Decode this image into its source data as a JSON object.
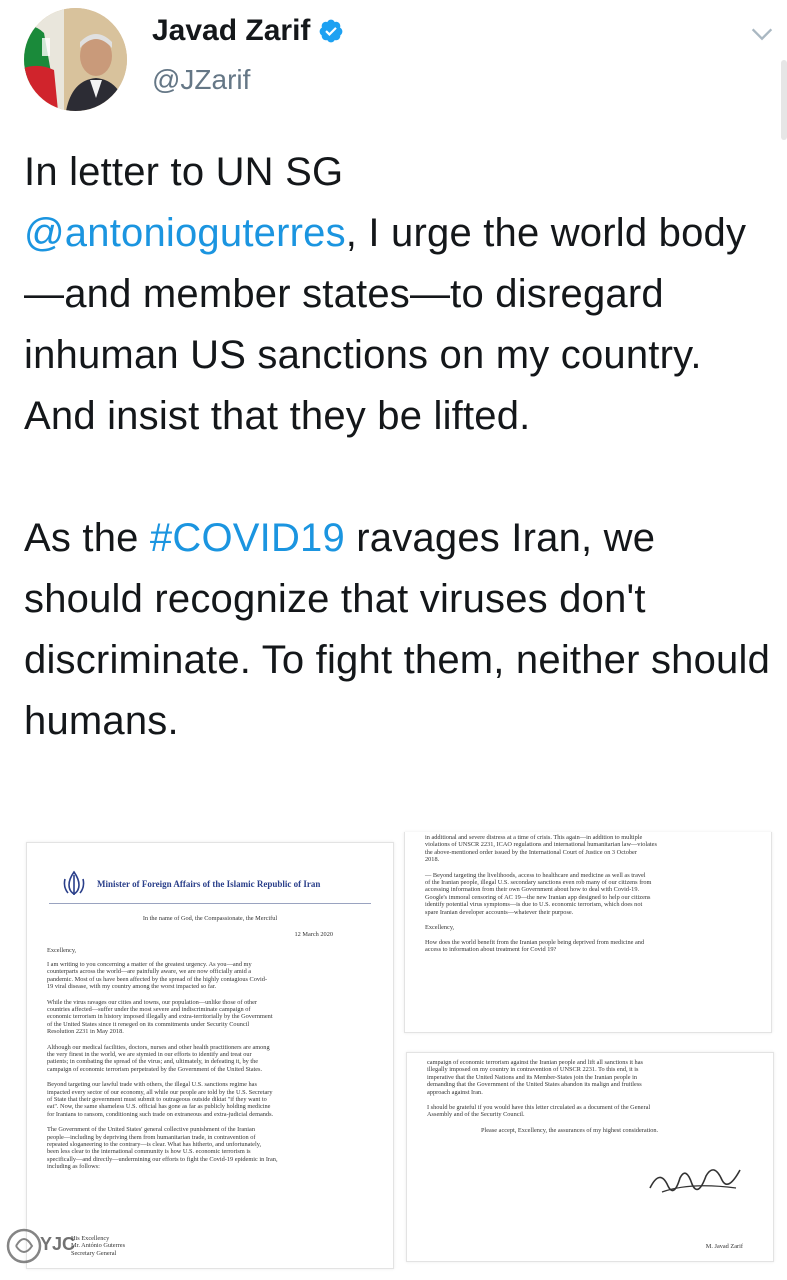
{
  "author": {
    "name": "Javad Zarif",
    "handle": "@JZarif"
  },
  "tweet": {
    "p1_a": "In letter to UN SG",
    "mention": "@antonioguterres",
    "p1_b": ", I urge the world body—and member states—to disregard inhuman US sanctions on my country. And insist that they be lifted.",
    "p2_a": "As the ",
    "hashtag": "#COVID19",
    "p2_b": " ravages Iran, we should recognize that viruses don't discriminate. To fight them, neither should humans."
  },
  "letter1": {
    "ministry": "Minister of Foreign Affairs of the Islamic Republic of Iran",
    "invocation": "In the name of God, the Compassionate, the Merciful",
    "date": "12 March 2020",
    "salutation": "Excellency,",
    "para1": [
      "I am writing to you concerning a matter of the greatest urgency. As you—and my",
      "counterparts across the world—are painfully aware, we are now officially amid a",
      "pandemic. Most of us have been affected by the spread of the highly contagious Covid-",
      "19 viral disease, with my country among the worst impacted so far."
    ],
    "para2": [
      "While the virus ravages our cities and towns, our population—unlike those of other",
      "countries affected—suffer under the most severe and indiscriminate campaign of",
      "economic terrorism in history imposed illegally and extra-territorially by the Government",
      "of the United States since it reneged on its commitments under Security Council",
      "Resolution 2231 in May 2018."
    ],
    "para3": [
      "Although our medical facilities, doctors, nurses and other health practitioners are among",
      "the very finest in the world, we are stymied in our efforts to identify and treat our",
      "patients; in combating the spread of the virus; and, ultimately, in defeating it, by the",
      "campaign of economic terrorism perpetrated by the Government of the United States."
    ],
    "para4": [
      "Beyond targeting our lawful trade with others, the illegal U.S. sanctions regime has",
      "impacted every sector of our economy, all while our people are told by the U.S. Secretary",
      "of State that their government must submit to outrageous outside diktat \"if they want to",
      "eat\". Now, the same shameless U.S. official has gone as far as publicly holding medicine",
      "for Iranians to ransom, conditioning such trade on extraneous and extra-judicial demands."
    ],
    "para5": [
      "The Government of the United States' general collective punishment of the Iranian",
      "people—including by depriving them from humanitarian trade, in contravention of",
      "repeated sloganeering to the contrary—is clear. What has hitherto, and unfortunately,",
      "been less clear to the international community is how U.S. economic terrorism is",
      "specifically—and directly—undermining our efforts to fight the Covid-19 epidemic in Iran,",
      "including as follows:"
    ],
    "footer": [
      "His Excellency",
      "Mr. António Guterres",
      "Secretary General"
    ]
  },
  "letter2": {
    "lines": [
      "in additional and severe distress at a time of crisis. This again—in addition to multiple",
      "violations of UNSCR 2231, ICAO regulations and international humanitarian law—violates",
      "the above-mentioned order issued by the International Court of Justice on 3 October",
      "2018."
    ],
    "para2": [
      "— Beyond targeting the livelihoods, access to healthcare and medicine as well as travel",
      "of the Iranian people, illegal U.S. secondary sanctions even rob many of our citizens from",
      "accessing information from their own Government about how to deal with Covid-19.",
      "Google's immoral censoring of AC 19—the new Iranian app designed to help our citizens",
      "identify potential virus symptoms—is due to U.S. economic terrorism, which does not",
      "spare Iranian developer accounts—whatever their purpose."
    ],
    "salutation": "Excellency,",
    "para3": [
      "How does the world benefit from the Iranian people being deprived from medicine and",
      "access to information about treatment for Covid 19?"
    ]
  },
  "letter3": {
    "para1": [
      "campaign of economic terrorism against the Iranian people and lift all sanctions it has",
      "illegally imposed on my country in contravention of UNSCR 2231. To this end, it is",
      "imperative that the United Nations and its Member-States join the Iranian people in",
      "demanding that the Government of the United States abandon its malign and fruitless",
      "approach against Iran."
    ],
    "para2": [
      "I should be grateful if you would have this letter circulated as a document of the General",
      "Assembly and of the Security Council."
    ],
    "closing": "Please accept, Excellency, the assurances of my highest consideration.",
    "signatory": "M. Javad Zarif"
  },
  "watermark": "YJC",
  "colors": {
    "link": "#1b95e0",
    "verified": "#1da1f2",
    "handle": "#657786",
    "text": "#14171a"
  }
}
